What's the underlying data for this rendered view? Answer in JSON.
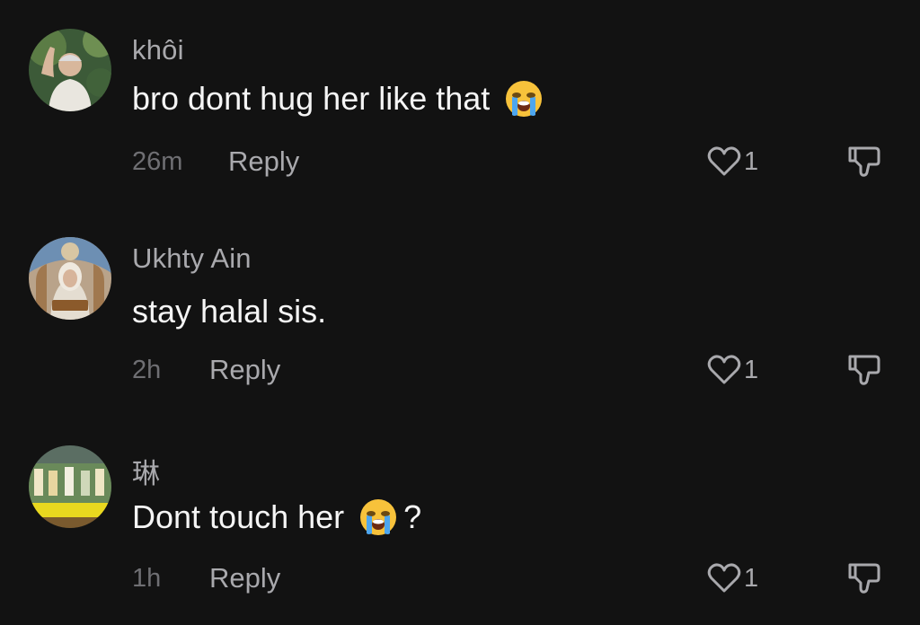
{
  "comments": [
    {
      "username": "khôi",
      "text": "bro dont hug her like that",
      "emoji": "loudly-crying-face",
      "suffix": "",
      "time": "26m",
      "reply_label": "Reply",
      "likes": "1"
    },
    {
      "username": "Ukhty Ain",
      "text": "stay halal sis.",
      "emoji": "",
      "suffix": "",
      "time": "2h",
      "reply_label": "Reply",
      "likes": "1"
    },
    {
      "username": "琳",
      "text": "Dont touch her",
      "emoji": "loudly-crying-face",
      "suffix": "?",
      "time": "1h",
      "reply_label": "Reply",
      "likes": "1"
    }
  ],
  "colors": {
    "background": "#121212",
    "username": "#a9a9ad",
    "text": "#f5f5f5",
    "timestamp": "#6f6f73"
  },
  "icons": [
    "heart-outline-icon",
    "thumbs-down-icon",
    "loudly-crying-face-emoji"
  ]
}
